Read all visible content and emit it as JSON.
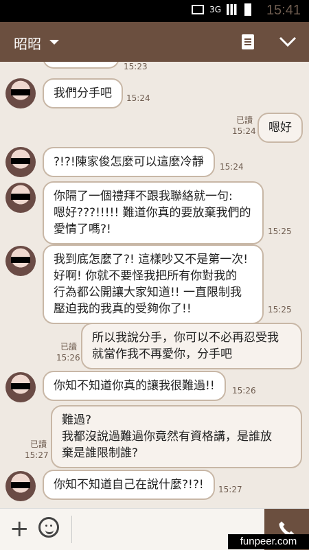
{
  "status": {
    "network": "3G",
    "time": "15:41"
  },
  "header": {
    "title": "昭昭"
  },
  "messages": [
    {
      "side": "left",
      "text": "我們分手吧",
      "time": "15:24"
    },
    {
      "side": "right",
      "read": "已讀",
      "time": "15:24",
      "text": "嗯好"
    },
    {
      "side": "left",
      "text": "?!?!陳家俊怎麼可以這麼冷靜",
      "time": "15:24"
    },
    {
      "side": "left",
      "lines": [
        "你隔了一個禮拜不跟我聯絡就一句:",
        "嗯好???!!!!! 難道你真的要放棄我們的",
        "愛情了嗎?!"
      ],
      "time": "15:25"
    },
    {
      "side": "left",
      "lines": [
        "我到底怎麼了?! 這樣吵又不是第一次!",
        "好啊! 你就不要怪我把所有你對我的",
        "行為都公開讓大家知道!! 一直限制我",
        "壓迫我的我真的受夠你了!!"
      ],
      "time": "15:25"
    },
    {
      "side": "right",
      "read": "已讀",
      "time": "15:26",
      "lines": [
        "所以我說分手，你可以不必再忍受我",
        "就當作我不再愛你，分手吧"
      ]
    },
    {
      "side": "left",
      "text": "你知不知道你真的讓我很難過!!",
      "time": "15:26"
    },
    {
      "side": "right",
      "read": "已讀",
      "time": "15:27",
      "lines": [
        "難過?",
        "我都沒說過難過你竟然有資格講，是誰放",
        "棄是誰限制誰?"
      ]
    },
    {
      "side": "left",
      "text": "你知不知道自己在說什麼?!?!",
      "time": "15:27"
    }
  ],
  "cutoff": {
    "top_time": "15:23"
  },
  "watermark": "funpeer.com"
}
